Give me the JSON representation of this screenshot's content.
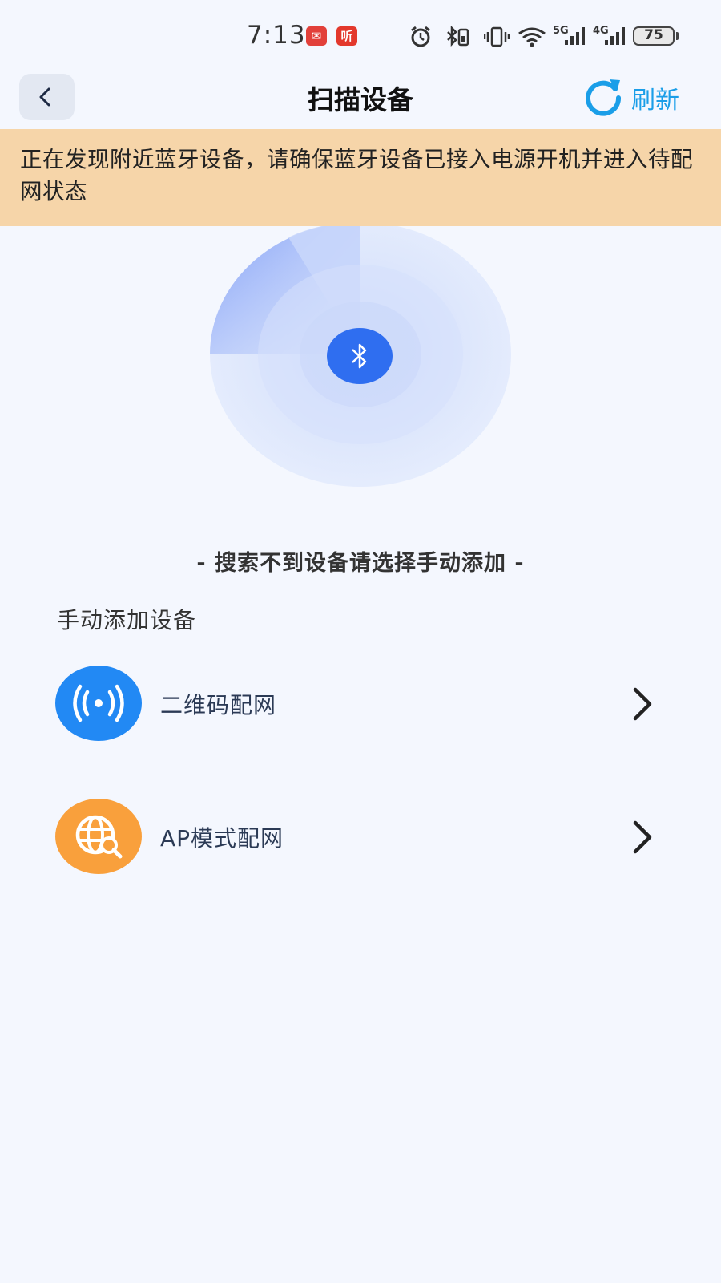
{
  "status_bar": {
    "time": "7:13",
    "app_badges": [
      "app-badge-1",
      "听"
    ],
    "network_5g": "5G",
    "network_4g": "4G",
    "battery": "75"
  },
  "header": {
    "title": "扫描设备",
    "refresh_label": "刷新"
  },
  "notice": {
    "text": "正在发现附近蓝牙设备，请确保蓝牙设备已接入电源开机并进入待配网状态",
    "background": "#f6d5a9"
  },
  "scan": {
    "icon": "bluetooth-icon",
    "hint": "- 搜索不到设备请选择手动添加 -"
  },
  "manual": {
    "section_title": "手动添加设备",
    "options": [
      {
        "label": "二维码配网",
        "icon": "signal-broadcast-icon",
        "color": "#2289f4"
      },
      {
        "label": "AP模式配网",
        "icon": "globe-search-icon",
        "color": "#f9a03c"
      }
    ]
  },
  "colors": {
    "accent": "#1a9ee8",
    "bluetooth": "#2f6ef0",
    "page_background": "#f4f7fe"
  }
}
